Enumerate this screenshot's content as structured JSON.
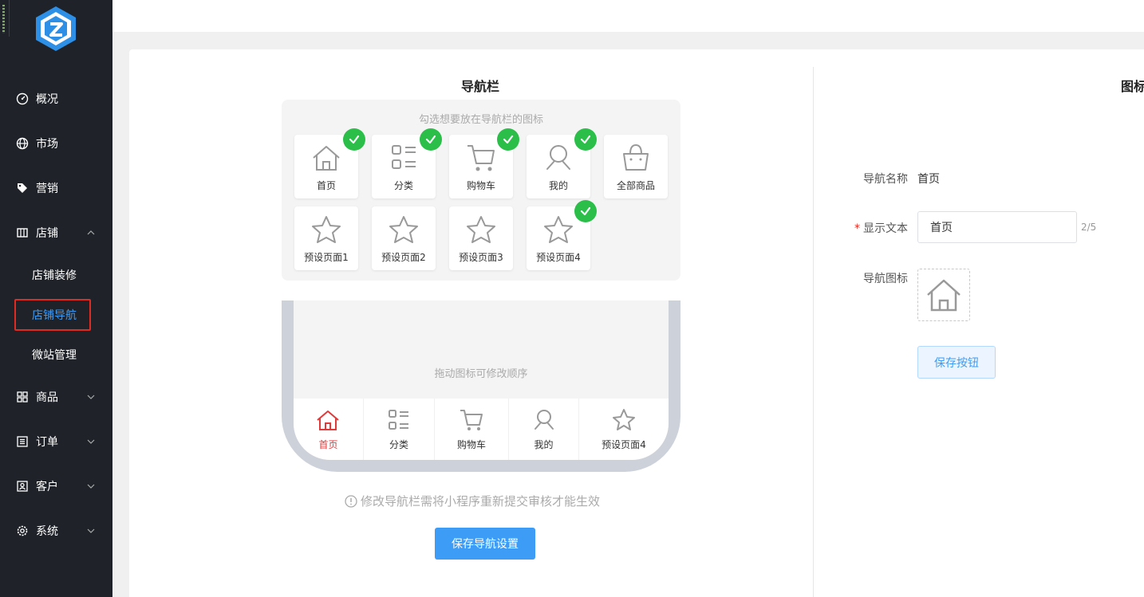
{
  "sidebar": {
    "items": [
      {
        "label": "概况",
        "icon": "dashboard-icon"
      },
      {
        "label": "市场",
        "icon": "globe-icon"
      },
      {
        "label": "营销",
        "icon": "tag-icon"
      },
      {
        "label": "店铺",
        "icon": "store-icon"
      },
      {
        "label": "商品",
        "icon": "grid-icon"
      },
      {
        "label": "订单",
        "icon": "order-list-icon"
      },
      {
        "label": "客户",
        "icon": "customer-icon"
      },
      {
        "label": "系统",
        "icon": "gear-icon"
      }
    ],
    "sub_items": [
      {
        "label": "店铺装修"
      },
      {
        "label": "店铺导航"
      },
      {
        "label": "微站管理"
      }
    ]
  },
  "navbar_section": {
    "title": "导航栏",
    "picker_hint": "勾选想要放在导航栏的图标",
    "tiles": [
      {
        "label": "首页",
        "icon": "home-icon",
        "checked": true
      },
      {
        "label": "分类",
        "icon": "category-icon",
        "checked": true
      },
      {
        "label": "购物车",
        "icon": "cart-icon",
        "checked": true
      },
      {
        "label": "我的",
        "icon": "user-icon",
        "checked": true
      },
      {
        "label": "全部商品",
        "icon": "bag-icon",
        "checked": false
      },
      {
        "label": "预设页面1",
        "icon": "star-icon",
        "checked": false
      },
      {
        "label": "预设页面2",
        "icon": "star-icon",
        "checked": false
      },
      {
        "label": "预设页面3",
        "icon": "star-icon",
        "checked": false
      },
      {
        "label": "预设页面4",
        "icon": "star-icon",
        "checked": true
      }
    ],
    "drag_hint": "拖动图标可修改顺序",
    "tabbar": [
      {
        "label": "首页",
        "icon": "home-icon",
        "selected": true
      },
      {
        "label": "分类",
        "icon": "category-icon",
        "selected": false
      },
      {
        "label": "购物车",
        "icon": "cart-icon",
        "selected": false
      },
      {
        "label": "我的",
        "icon": "user-icon",
        "selected": false
      },
      {
        "label": "预设页面4",
        "icon": "star-icon",
        "selected": false
      }
    ],
    "notice": "修改导航栏需将小程序重新提交审核才能生效",
    "save_button": "保存导航设置"
  },
  "icon_section": {
    "title": "图标",
    "name_label": "导航名称",
    "name_value": "首页",
    "text_label": "显示文本",
    "text_value": "首页",
    "text_count": "2/5",
    "icon_label": "导航图标",
    "save_button": "保存按钮"
  },
  "colors": {
    "sidebar_bg": "#1f2329",
    "accent": "#3d9cf5",
    "check_green": "#2bbf4a",
    "selected_tab": "#e03a3a"
  }
}
